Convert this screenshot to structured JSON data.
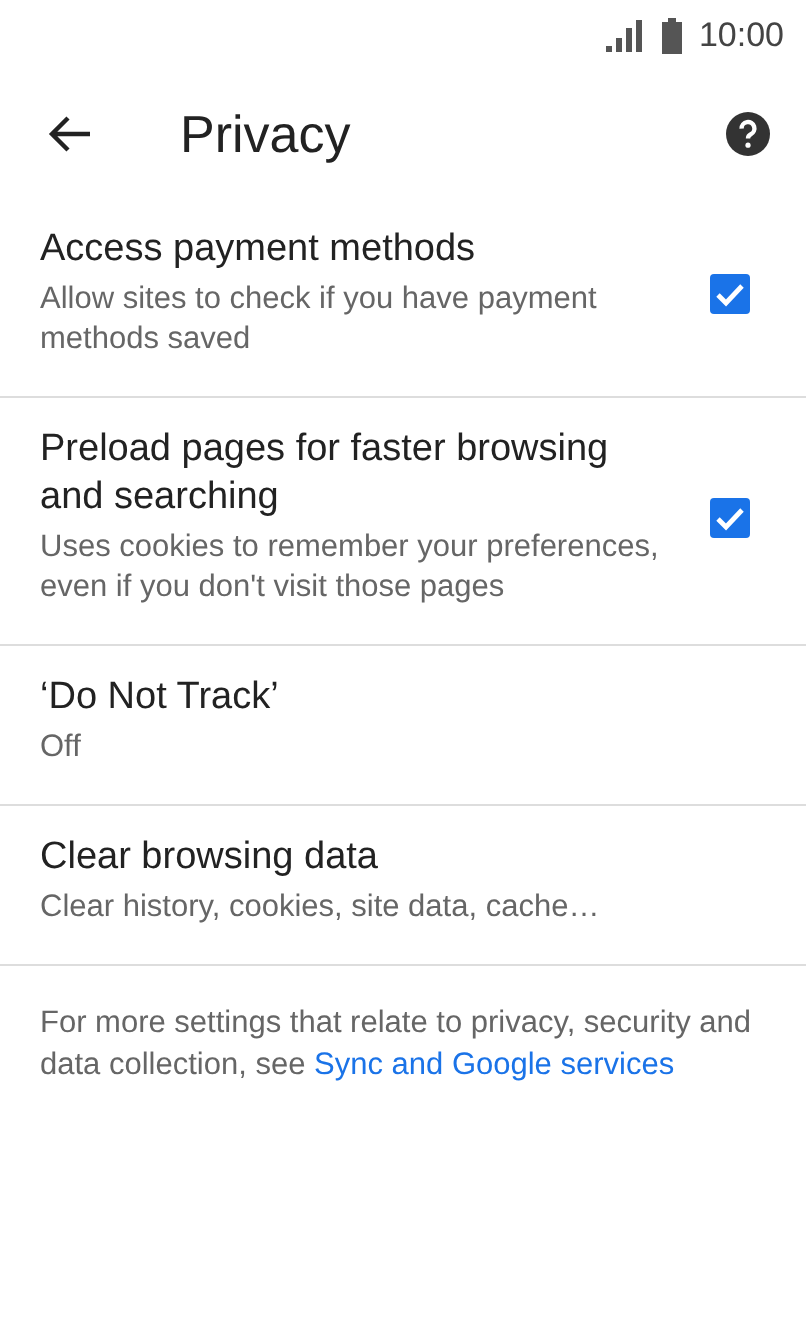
{
  "status_bar": {
    "time": "10:00"
  },
  "app_bar": {
    "title": "Privacy"
  },
  "settings": [
    {
      "kind": "checkbox",
      "title": "Access payment methods",
      "summary": "Allow sites to check if you have payment methods saved",
      "checked": true
    },
    {
      "kind": "checkbox",
      "title": "Preload pages for faster browsing and searching",
      "summary": "Uses cookies to remember your preferences, even if you don't visit those pages",
      "checked": true
    },
    {
      "kind": "plain",
      "title": "‘Do Not Track’",
      "summary": "Off"
    },
    {
      "kind": "plain",
      "title": "Clear browsing data",
      "summary": "Clear history, cookies, site data, cache…"
    }
  ],
  "footer": {
    "text": "For more settings that relate to privacy, security and data collection, see",
    "link": "Sync and Google services"
  }
}
